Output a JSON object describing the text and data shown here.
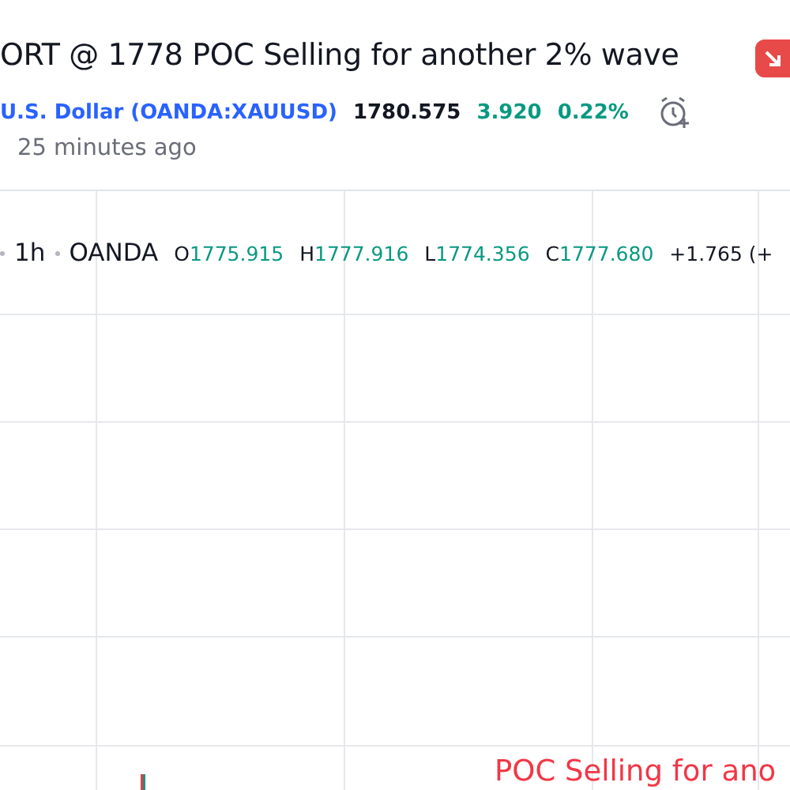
{
  "idea": {
    "title": "ORT @ 1778 POC Selling for another 2% wave",
    "symbol_link": "U.S. Dollar (OANDA:XAUUSD)",
    "price": "1780.575",
    "change": "3.920",
    "change_percent": "0.22%",
    "published": "25 minutes ago"
  },
  "chart": {
    "interval": "1h",
    "exchange": "OANDA",
    "ohlc": [
      {
        "label": "O",
        "value": "1775.915"
      },
      {
        "label": "H",
        "value": "1777.916"
      },
      {
        "label": "L",
        "value": "1774.356"
      },
      {
        "label": "C",
        "value": "1777.680"
      }
    ],
    "delta": "+1.765 (+",
    "annotation": "POC Selling for ano"
  }
}
